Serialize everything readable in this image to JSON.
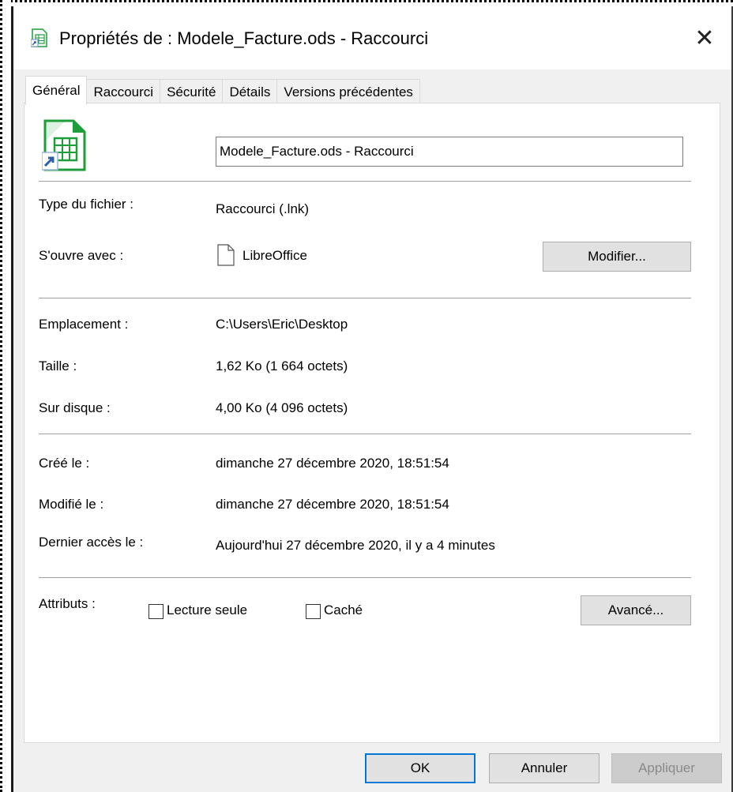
{
  "window": {
    "title": "Propriétés de : Modele_Facture.ods - Raccourci",
    "close_glyph": "✕"
  },
  "tabs": [
    {
      "label": "Général",
      "active": true
    },
    {
      "label": "Raccourci",
      "active": false
    },
    {
      "label": "Sécurité",
      "active": false
    },
    {
      "label": "Détails",
      "active": false
    },
    {
      "label": "Versions précédentes",
      "active": false
    }
  ],
  "general": {
    "file_name": "Modele_Facture.ods - Raccourci",
    "type_label": "Type du fichier :",
    "type_value": "Raccourci (.lnk)",
    "opens_label": "S'ouvre avec :",
    "opens_value": "LibreOffice",
    "modify_button": "Modifier...",
    "location_label": "Emplacement :",
    "location_value": "C:\\Users\\Eric\\Desktop",
    "size_label": "Taille :",
    "size_value": "1,62 Ko (1 664 octets)",
    "disk_label": "Sur disque :",
    "disk_value": "4,00 Ko (4 096 octets)",
    "created_label": "Créé le :",
    "created_value": "dimanche 27 décembre 2020, 18:51:54",
    "modified_label": "Modifié le :",
    "modified_value": "dimanche 27 décembre 2020, 18:51:54",
    "accessed_label": "Dernier accès le :",
    "accessed_value": "Aujourd'hui 27 décembre 2020, il y a 4 minutes",
    "attributes_label": "Attributs :",
    "readonly_label": "Lecture seule",
    "readonly_checked": false,
    "hidden_label": "Caché",
    "hidden_checked": false,
    "advanced_button": "Avancé..."
  },
  "footer": {
    "ok_button": "OK",
    "cancel_button": "Annuler",
    "apply_button": "Appliquer"
  },
  "colors": {
    "accent": "#0078d7",
    "calc_green": "#1e9e3a"
  }
}
